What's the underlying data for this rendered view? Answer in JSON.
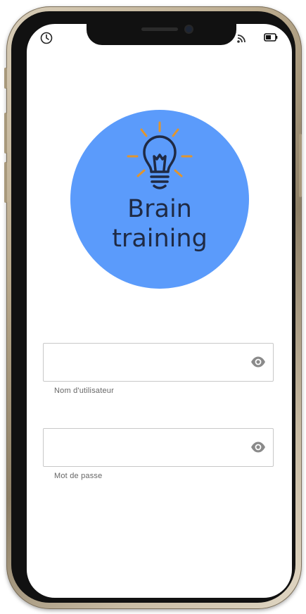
{
  "status_bar": {
    "left_icon": "clock-icon",
    "right_icons": [
      "cast-icon",
      "battery-icon"
    ]
  },
  "logo": {
    "icon": "lightbulb-icon",
    "line1": "Brain",
    "line2": "training",
    "circle_color": "#5b9bfb",
    "text_color": "#1f2a44",
    "ray_color": "#e0952f"
  },
  "form": {
    "username": {
      "value": "",
      "helper": "Nom d'utilisateur",
      "toggle_icon": "eye-icon"
    },
    "password": {
      "value": "",
      "helper": "Mot de passe",
      "toggle_icon": "eye-icon"
    }
  }
}
